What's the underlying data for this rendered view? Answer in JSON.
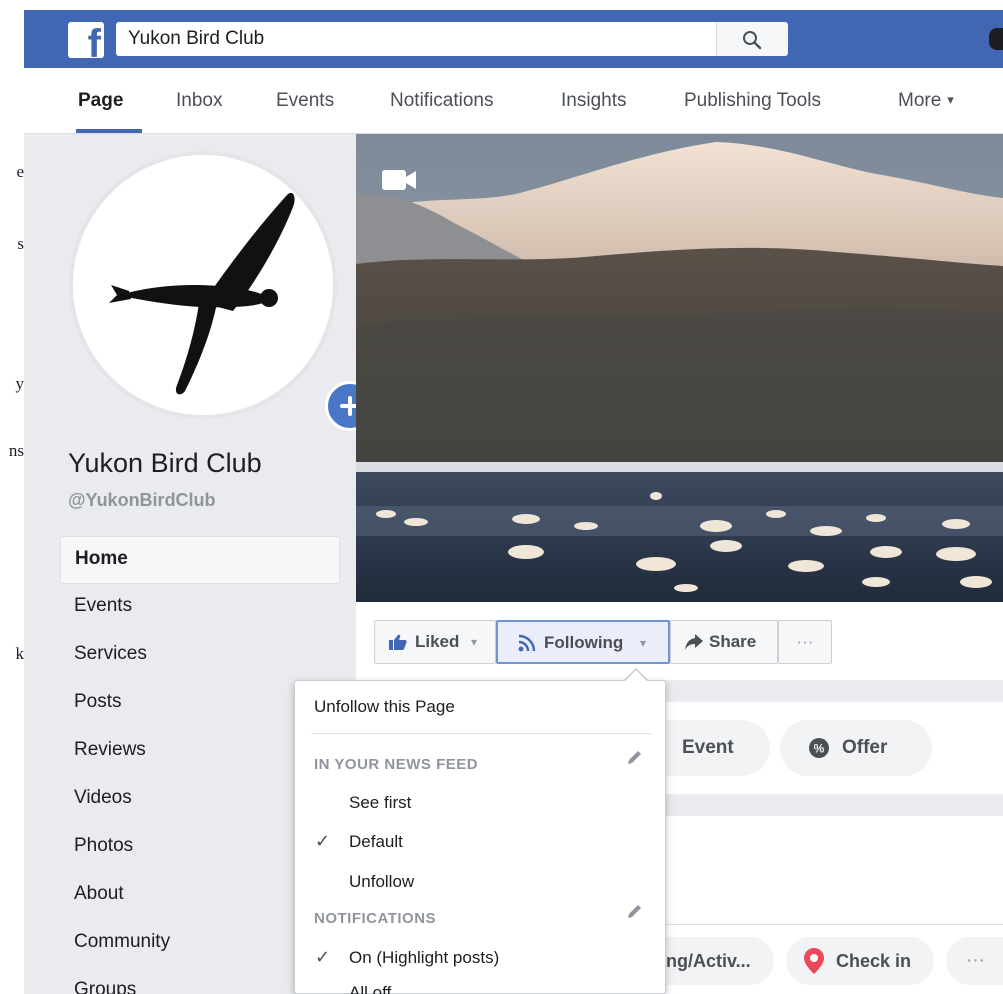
{
  "left_strip": [
    "e",
    "s",
    "y",
    "ns",
    "k"
  ],
  "topbar": {
    "logo": "f",
    "search_value": "Yukon Bird Club",
    "search_placeholder": "Search"
  },
  "nav": {
    "tabs": [
      {
        "label": "Page"
      },
      {
        "label": "Inbox"
      },
      {
        "label": "Events"
      },
      {
        "label": "Notifications"
      },
      {
        "label": "Insights"
      },
      {
        "label": "Publishing Tools"
      },
      {
        "label": "More"
      }
    ],
    "more_caret": "▾"
  },
  "sidebar": {
    "page_name": "Yukon Bird Club",
    "page_handle": "@YukonBirdClub",
    "items": [
      {
        "label": "Home"
      },
      {
        "label": "Events"
      },
      {
        "label": "Services"
      },
      {
        "label": "Posts"
      },
      {
        "label": "Reviews"
      },
      {
        "label": "Videos"
      },
      {
        "label": "Photos"
      },
      {
        "label": "About"
      },
      {
        "label": "Community"
      },
      {
        "label": "Groups"
      }
    ]
  },
  "action_bar": {
    "liked_label": "Liked",
    "following_label": "Following",
    "share_label": "Share",
    "more_label": "···",
    "caret": "▾"
  },
  "composer": {
    "event_label": "Event",
    "offer_label": "Offer"
  },
  "post_actions": {
    "feeling_label": "ng/Activ...",
    "checkin_label": "Check in",
    "more_label": "···"
  },
  "dropdown": {
    "unfollow_page": "Unfollow this Page",
    "news_feed_header": "IN YOUR NEWS FEED",
    "see_first": "See first",
    "default": "Default",
    "unfollow": "Unfollow",
    "notifications_header": "NOTIFICATIONS",
    "on_highlight": "On (Highlight posts)",
    "all_off": "All off",
    "check": "✓"
  },
  "colors": {
    "brand_blue": "#4267b2",
    "page_gray": "#e9ebee"
  }
}
